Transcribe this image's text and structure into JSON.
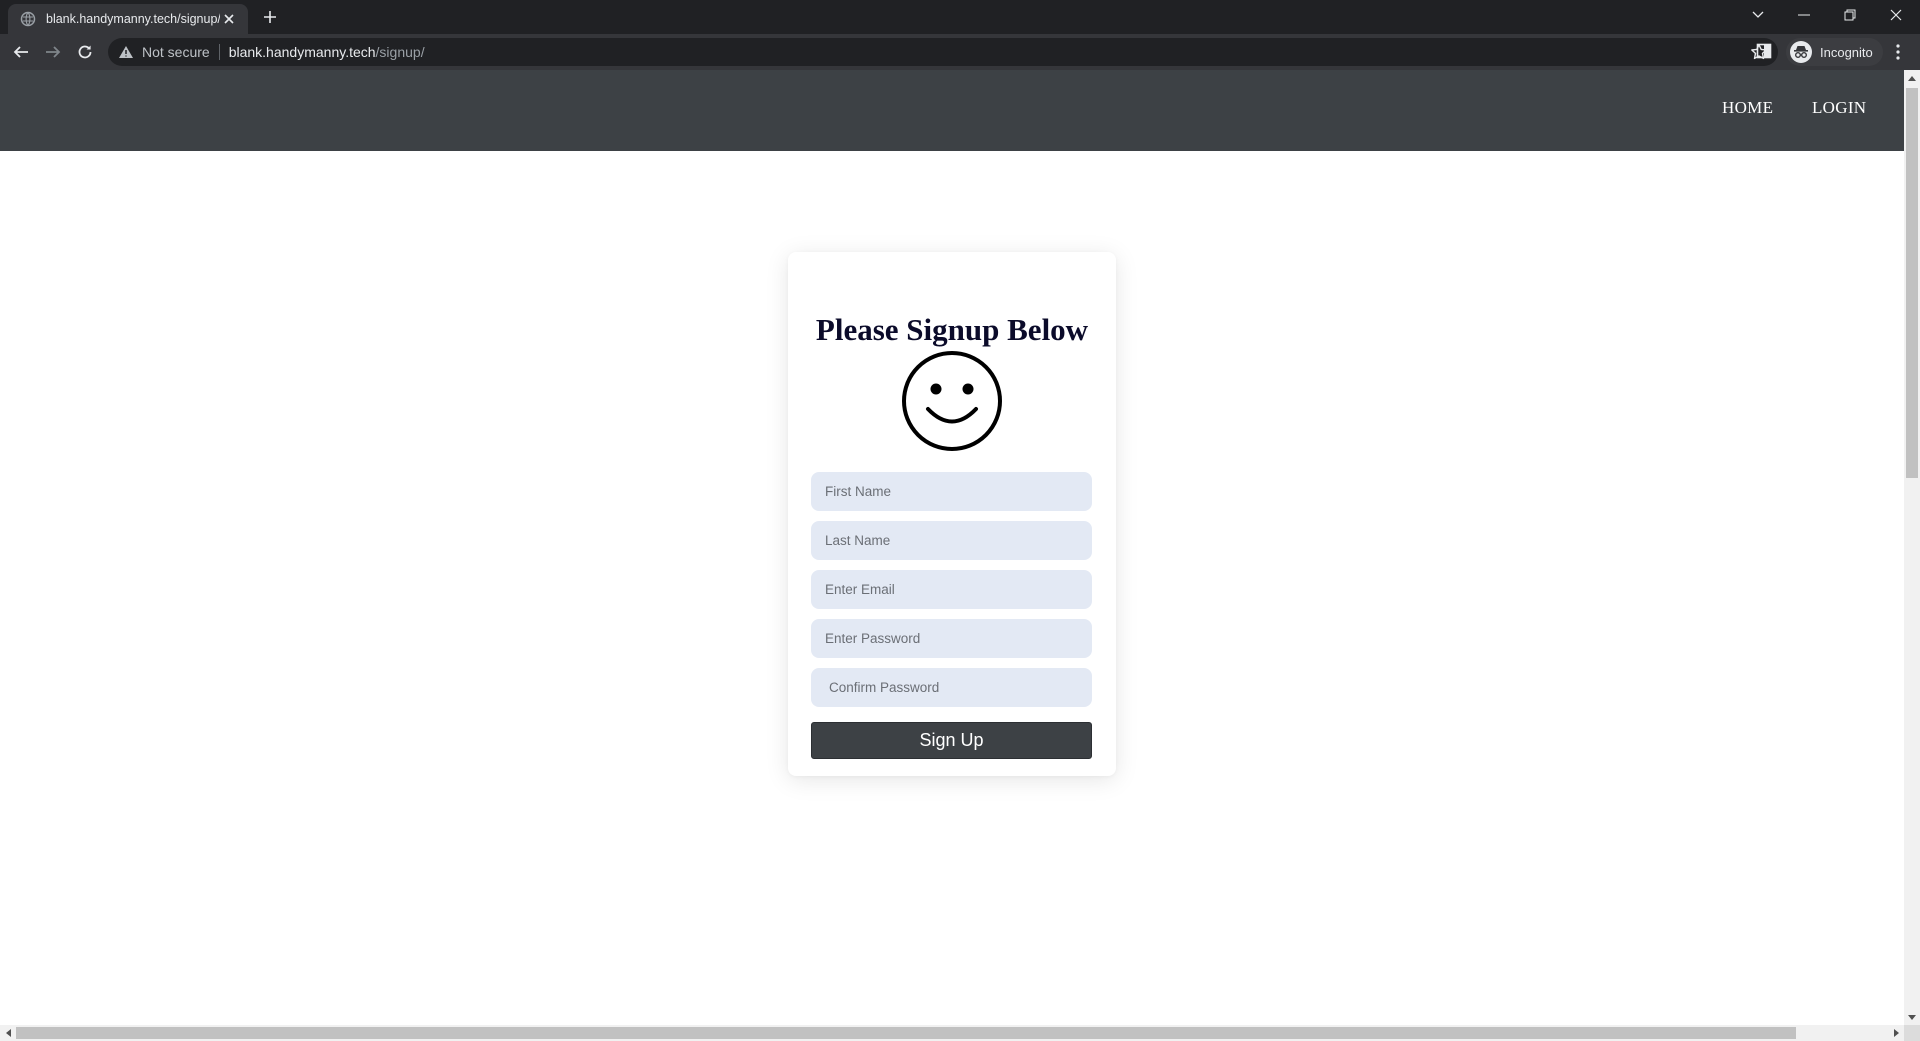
{
  "browser": {
    "tab_title": "blank.handymanny.tech/signup/",
    "security_label": "Not secure",
    "url_host": "blank.handymanny.tech",
    "url_path": "/signup/",
    "profile_label": "Incognito"
  },
  "site_nav": {
    "links": [
      {
        "label": "HOME"
      },
      {
        "label": "LOGIN"
      }
    ]
  },
  "signup_form": {
    "title": "Please Signup Below",
    "avatar_icon": "smiley-face-icon",
    "fields": {
      "first_name_placeholder": "First Name",
      "last_name_placeholder": "Last Name",
      "email_placeholder": "Enter Email",
      "password_placeholder": "Enter Password",
      "confirm_password_placeholder": "Confirm Password"
    },
    "submit_label": "Sign Up"
  },
  "colors": {
    "nav_background": "#3d4145",
    "input_background": "#e3e9f4",
    "button_background": "#3d4145",
    "title_color": "#0b0b2a"
  }
}
